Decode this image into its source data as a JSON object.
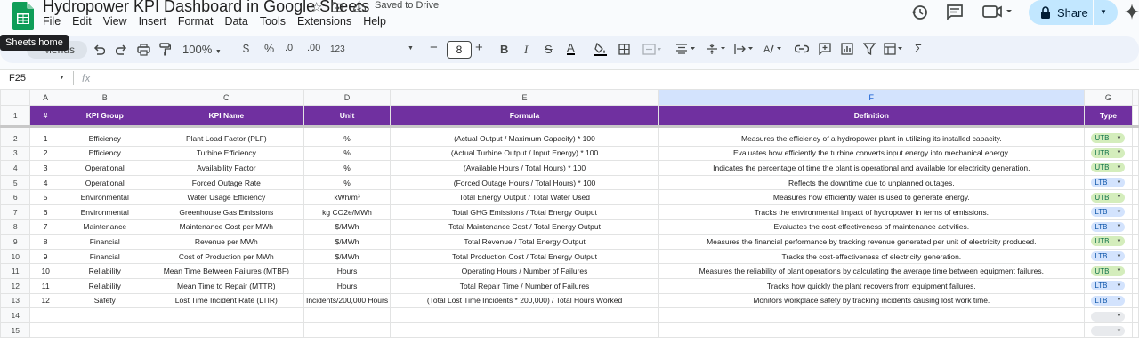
{
  "doc": {
    "title": "Hydropower KPI Dashboard in Google Sheets",
    "saved_status": "Saved to Drive"
  },
  "menu": [
    "File",
    "Edit",
    "View",
    "Insert",
    "Format",
    "Data",
    "Tools",
    "Extensions",
    "Help"
  ],
  "share": {
    "label": "Share"
  },
  "tooltip": "Sheets home",
  "toolbar": {
    "search_label": "Menus",
    "zoom": "100%",
    "currency": "$",
    "percent": "%",
    "dec_decrease": ".0",
    "dec_increase": ".00",
    "number_format": "123",
    "font_size": "8"
  },
  "formula_bar": {
    "cell_ref": "F25",
    "fx": "fx",
    "value": ""
  },
  "columns": [
    "A",
    "B",
    "C",
    "D",
    "E",
    "F",
    "G"
  ],
  "selected_column": "F",
  "headers": [
    "#",
    "KPI Group",
    "KPI Name",
    "Unit",
    "Formula",
    "Definition",
    "Type"
  ],
  "rows": [
    {
      "n": "1",
      "group": "Efficiency",
      "name": "Plant Load Factor (PLF)",
      "unit": "%",
      "formula": "(Actual Output / Maximum Capacity) * 100",
      "definition": "Measures the efficiency of a hydropower plant in utilizing its installed capacity.",
      "type": "UTB"
    },
    {
      "n": "2",
      "group": "Efficiency",
      "name": "Turbine Efficiency",
      "unit": "%",
      "formula": "(Actual Turbine Output / Input Energy) * 100",
      "definition": "Evaluates how efficiently the turbine converts input energy into mechanical energy.",
      "type": "UTB"
    },
    {
      "n": "3",
      "group": "Operational",
      "name": "Availability Factor",
      "unit": "%",
      "formula": "(Available Hours / Total Hours) * 100",
      "definition": "Indicates the percentage of time the plant is operational and available for electricity generation.",
      "type": "UTB"
    },
    {
      "n": "4",
      "group": "Operational",
      "name": "Forced Outage Rate",
      "unit": "%",
      "formula": "(Forced Outage Hours / Total Hours) * 100",
      "definition": "Reflects the downtime due to unplanned outages.",
      "type": "LTB"
    },
    {
      "n": "5",
      "group": "Environmental",
      "name": "Water Usage Efficiency",
      "unit": "kWh/m³",
      "formula": "Total Energy Output / Total Water Used",
      "definition": "Measures how efficiently water is used to generate energy.",
      "type": "UTB"
    },
    {
      "n": "6",
      "group": "Environmental",
      "name": "Greenhouse Gas Emissions",
      "unit": "kg CO2e/MWh",
      "formula": "Total GHG Emissions / Total Energy Output",
      "definition": "Tracks the environmental impact of hydropower in terms of emissions.",
      "type": "LTB"
    },
    {
      "n": "7",
      "group": "Maintenance",
      "name": "Maintenance Cost per MWh",
      "unit": "$/MWh",
      "formula": "Total Maintenance Cost / Total Energy Output",
      "definition": "Evaluates the cost-effectiveness of maintenance activities.",
      "type": "LTB"
    },
    {
      "n": "8",
      "group": "Financial",
      "name": "Revenue per MWh",
      "unit": "$/MWh",
      "formula": "Total Revenue / Total Energy Output",
      "definition": "Measures the financial performance by tracking revenue generated per unit of electricity produced.",
      "type": "UTB"
    },
    {
      "n": "9",
      "group": "Financial",
      "name": "Cost of Production per MWh",
      "unit": "$/MWh",
      "formula": "Total Production Cost / Total Energy Output",
      "definition": "Tracks the cost-effectiveness of electricity generation.",
      "type": "LTB"
    },
    {
      "n": "10",
      "group": "Reliability",
      "name": "Mean Time Between Failures (MTBF)",
      "unit": "Hours",
      "formula": "Operating Hours / Number of Failures",
      "definition": "Measures the reliability of plant operations by calculating the average time between equipment failures.",
      "type": "UTB"
    },
    {
      "n": "11",
      "group": "Reliability",
      "name": "Mean Time to Repair (MTTR)",
      "unit": "Hours",
      "formula": "Total Repair Time / Number of Failures",
      "definition": "Tracks how quickly the plant recovers from equipment failures.",
      "type": "LTB"
    },
    {
      "n": "12",
      "group": "Safety",
      "name": "Lost Time Incident Rate (LTIR)",
      "unit": "Incidents/200,000 Hours",
      "formula": "(Total Lost Time Incidents * 200,000) / Total Hours Worked",
      "definition": "Monitors workplace safety by tracking incidents causing lost work time.",
      "type": "LTB"
    }
  ],
  "row_numbers": [
    "1",
    "2",
    "3",
    "4",
    "5",
    "6",
    "7",
    "8",
    "9",
    "10",
    "11",
    "12",
    "13",
    "14",
    "15"
  ],
  "colors": {
    "header_bg": "#7030a0",
    "utb_chip": "#d4edbc",
    "ltb_chip": "#d3e3fd",
    "share_bg": "#c2e7ff"
  }
}
